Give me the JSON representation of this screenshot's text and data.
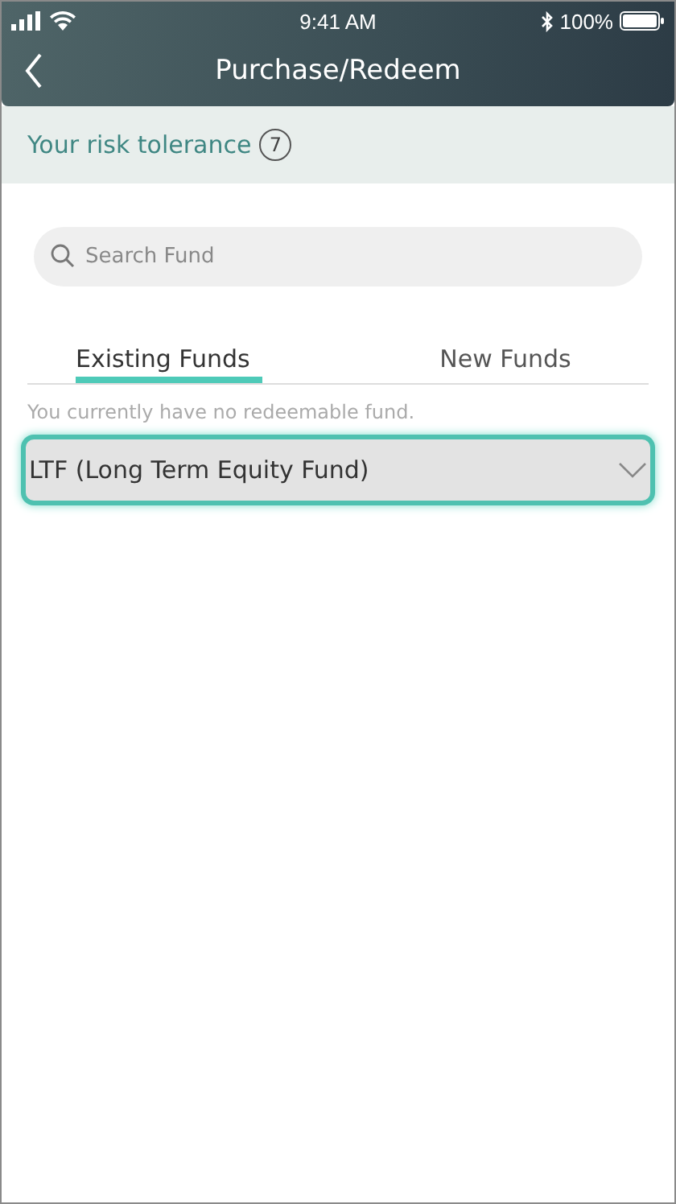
{
  "status_bar": {
    "time": "9:41 AM",
    "battery": "100%"
  },
  "header": {
    "title": "Purchase/Redeem"
  },
  "risk": {
    "label": "Your risk tolerance",
    "level_badge": "7"
  },
  "search": {
    "placeholder": "Search Fund"
  },
  "tabs": [
    {
      "label": "Existing Funds",
      "selected": true
    },
    {
      "label": "New Funds",
      "selected": false
    }
  ],
  "message": "You currently have no redeemable fund.",
  "sections": [
    {
      "title": "LTF (Long Term Equity Fund)",
      "expanded": false,
      "selected": true
    }
  ]
}
